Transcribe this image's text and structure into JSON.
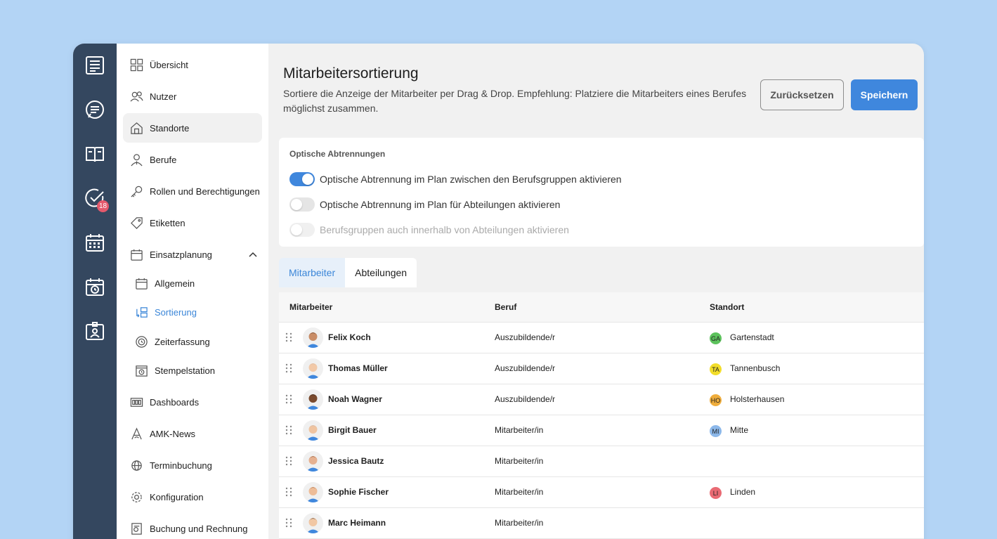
{
  "rail": {
    "tasks_badge": "18"
  },
  "nav": {
    "items": [
      {
        "label": "Übersicht",
        "icon": "grid-icon"
      },
      {
        "label": "Nutzer",
        "icon": "users-icon"
      },
      {
        "label": "Standorte",
        "icon": "house-icon"
      },
      {
        "label": "Berufe",
        "icon": "person-badge-icon"
      },
      {
        "label": "Rollen und Berechtigungen",
        "icon": "key-icon"
      },
      {
        "label": "Etiketten",
        "icon": "tag-icon"
      },
      {
        "label": "Einsatzplanung",
        "icon": "calendar-icon"
      }
    ],
    "sub_items": [
      {
        "label": "Allgemein",
        "icon": "calendar-icon"
      },
      {
        "label": "Sortierung",
        "icon": "sort-icon"
      },
      {
        "label": "Zeiterfassung",
        "icon": "clock-refresh-icon"
      },
      {
        "label": "Stempelstation",
        "icon": "stamp-clock-icon"
      }
    ],
    "bottom_items": [
      {
        "label": "Dashboards",
        "icon": "dashboard-icon"
      },
      {
        "label": "AMK-News",
        "icon": "news-icon"
      },
      {
        "label": "Terminbuchung",
        "icon": "globe-icon"
      },
      {
        "label": "Konfiguration",
        "icon": "gear-icon"
      },
      {
        "label": "Buchung und Rechnung",
        "icon": "invoice-icon"
      }
    ]
  },
  "header": {
    "title": "Mitarbeitersortierung",
    "subtitle": "Sortiere die Anzeige der Mitarbeiter per Drag & Drop. Empfehlung: Platziere die Mitarbeiters eines Berufes möglichst zusammen.",
    "reset_label": "Zurücksetzen",
    "save_label": "Speichern"
  },
  "separation": {
    "title": "Optische Abtrennungen",
    "toggles": [
      {
        "label": "Optische Abtrennung im Plan zwischen den Berufsgruppen aktivieren",
        "state": "on"
      },
      {
        "label": "Optische Abtrennung im Plan für Abteilungen aktivieren",
        "state": "off"
      },
      {
        "label": "Berufsgruppen auch innerhalb von Abteilungen aktivieren",
        "state": "disabled"
      }
    ]
  },
  "tabs": [
    {
      "label": "Mitarbeiter",
      "active": true
    },
    {
      "label": "Abteilungen",
      "active": false
    }
  ],
  "table": {
    "columns": [
      "Mitarbeiter",
      "Beruf",
      "Standort"
    ],
    "rows": [
      {
        "name": "Felix Koch",
        "job": "Auszubildende/r",
        "loc_code": "GA",
        "loc": "Gartenstadt",
        "loc_color": "#5cc25c"
      },
      {
        "name": "Thomas Müller",
        "job": "Auszubildende/r",
        "loc_code": "TA",
        "loc": "Tannenbusch",
        "loc_color": "#f2dd2a"
      },
      {
        "name": "Noah Wagner",
        "job": "Auszubildende/r",
        "loc_code": "HO",
        "loc": "Holsterhausen",
        "loc_color": "#efad3c"
      },
      {
        "name": "Birgit Bauer",
        "job": "Mitarbeiter/in",
        "loc_code": "MI",
        "loc": "Mitte",
        "loc_color": "#8cb8ea"
      },
      {
        "name": "Jessica Bautz",
        "job": "Mitarbeiter/in",
        "loc_code": "",
        "loc": "",
        "loc_color": ""
      },
      {
        "name": "Sophie Fischer",
        "job": "Mitarbeiter/in",
        "loc_code": "LI",
        "loc": "Linden",
        "loc_color": "#e96a73"
      },
      {
        "name": "Marc Heimann",
        "job": "Mitarbeiter/in",
        "loc_code": "",
        "loc": "",
        "loc_color": ""
      }
    ]
  }
}
